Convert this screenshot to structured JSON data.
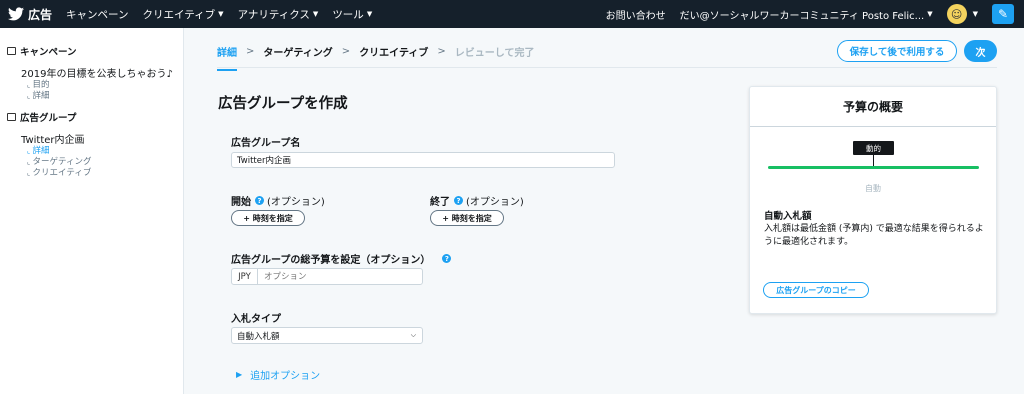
{
  "topnav": {
    "logo_text": "広告",
    "menu": [
      {
        "label": "キャンペーン",
        "has_dropdown": false
      },
      {
        "label": "クリエイティブ",
        "has_dropdown": true
      },
      {
        "label": "アナリティクス",
        "has_dropdown": true
      },
      {
        "label": "ツール",
        "has_dropdown": true
      }
    ],
    "contact": "お問い合わせ",
    "account": "だい@ソーシャルワーカーコミュニティ Posto Felic..."
  },
  "sidebar": {
    "campaign_header": "キャンペーン",
    "campaign_name": "2019年の目標を公表しちゃおう♪",
    "campaign_subs": [
      "目的",
      "詳細"
    ],
    "adgroup_header": "広告グループ",
    "adgroup_name": "Twitter内企画",
    "adgroup_subs": [
      "詳細",
      "ターゲティング",
      "クリエイティブ"
    ]
  },
  "steps": [
    "詳細",
    "ターゲティング",
    "クリエイティブ",
    "レビューして完了"
  ],
  "buttons": {
    "save_later": "保存して後で利用する",
    "next": "次"
  },
  "form": {
    "title": "広告グループを作成",
    "name_label": "広告グループ名",
    "name_value": "Twitter内企画",
    "start_label": "開始",
    "end_label": "終了",
    "optional": "(オプション)",
    "set_time": "+ 時刻を指定",
    "budget_label": "広告グループの総予算を設定（オプション）",
    "currency": "JPY",
    "budget_placeholder": "オプション",
    "bid_type_label": "入札タイプ",
    "bid_type_value": "自動入札額",
    "more_options": "追加オプション"
  },
  "budget_panel": {
    "title": "予算の概要",
    "tag": "動的",
    "caption": "自動",
    "bid_heading": "自動入札額",
    "bid_description": "入札額は最低金額 (予算内) で最適な結果を得られるように最適化されます。",
    "copy_button": "広告グループのコピー"
  },
  "colors": {
    "accent": "#1da1f2",
    "nav_bg": "#15202b",
    "green": "#17bf63"
  }
}
